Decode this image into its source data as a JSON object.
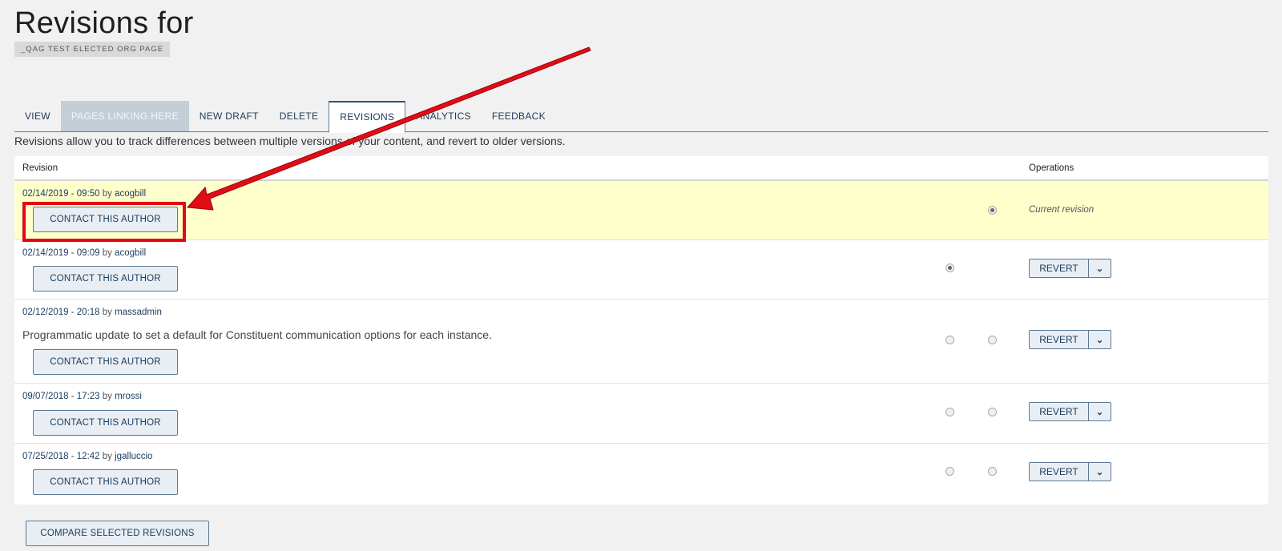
{
  "page": {
    "title": "Revisions for",
    "tag": "_QAG TEST ELECTED ORG PAGE",
    "description": "Revisions allow you to track differences between multiple versions of your content, and revert to older versions."
  },
  "tabs": [
    {
      "label": "VIEW"
    },
    {
      "label": "PAGES LINKING HERE"
    },
    {
      "label": "NEW DRAFT"
    },
    {
      "label": "DELETE"
    },
    {
      "label": "REVISIONS"
    },
    {
      "label": "ANALYTICS"
    },
    {
      "label": "FEEDBACK"
    }
  ],
  "table": {
    "col_revision": "Revision",
    "col_operations": "Operations",
    "by": "by",
    "contact_label": "CONTACT THIS AUTHOR",
    "revert_label": "REVERT",
    "current_label": "Current revision",
    "rows": [
      {
        "date": "02/14/2019 - 09:50",
        "user": "acogbill",
        "log": ""
      },
      {
        "date": "02/14/2019 - 09:09",
        "user": "acogbill",
        "log": ""
      },
      {
        "date": "02/12/2019 - 20:18",
        "user": "massadmin",
        "log": "Programmatic update to set a default for Constituent communication options for each instance."
      },
      {
        "date": "09/07/2018 - 17:23",
        "user": "mrossi",
        "log": ""
      },
      {
        "date": "07/25/2018 - 12:42",
        "user": "jgalluccio",
        "log": ""
      }
    ]
  },
  "compare_label": "COMPARE SELECTED REVISIONS",
  "colors": {
    "accent": "#1b3a5c",
    "annotation": "#e30613",
    "current_row": "#ffffcc"
  }
}
